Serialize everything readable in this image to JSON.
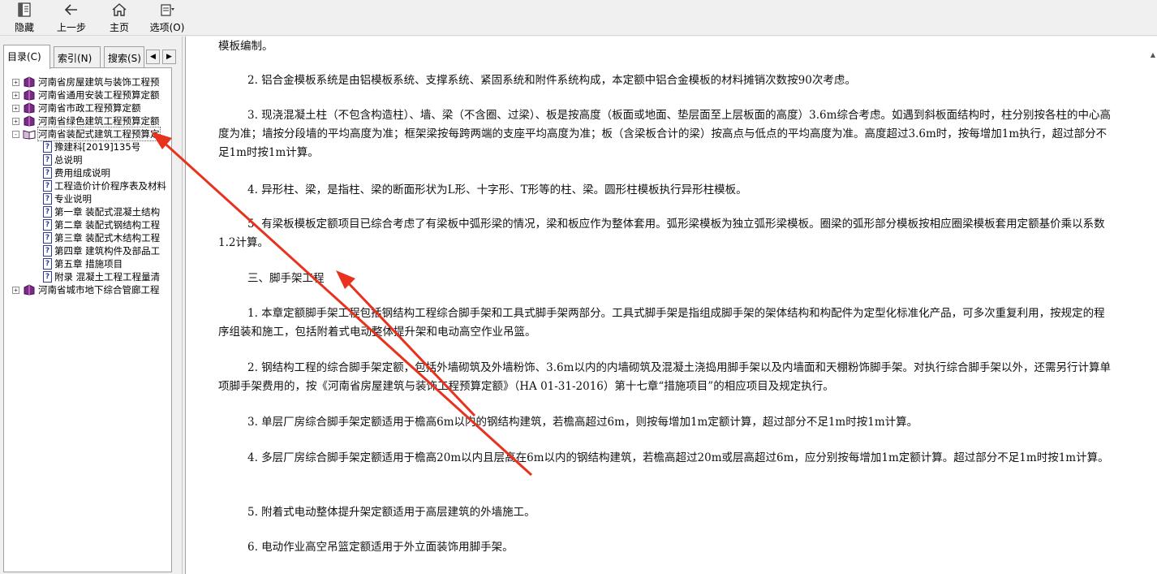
{
  "toolbar": {
    "hide_label": "隐藏",
    "back_label": "上一步",
    "home_label": "主页",
    "options_label": "选项(O)"
  },
  "tabs": {
    "toc_label": "目录(C)",
    "index_label": "索引(N)",
    "search_label": "搜索(S)"
  },
  "tree": {
    "items": [
      {
        "label": "河南省房屋建筑与装饰工程预",
        "expander": "+"
      },
      {
        "label": "河南省通用安装工程预算定额",
        "expander": "+"
      },
      {
        "label": "河南省市政工程预算定额",
        "expander": "+"
      },
      {
        "label": "河南省绿色建筑工程预算定额",
        "expander": "+"
      },
      {
        "label": "河南省装配式建筑工程预算定",
        "expander": "-"
      },
      {
        "label": "河南省城市地下综合管廊工程",
        "expander": "+"
      }
    ],
    "children": [
      "豫建科[2019]135号",
      "总说明",
      "费用组成说明",
      "工程造价计价程序表及材料",
      "专业说明",
      "第一章  装配式混凝土结构",
      "第二章  装配式钢结构工程",
      "第三章  装配式木结构工程",
      "第四章  建筑构件及部品工",
      "第五章  措施项目",
      "附录  混凝土工程工程量清"
    ],
    "page_glyph": "?"
  },
  "content": {
    "p0": "模板编制。",
    "p1": "2. 铝合金模板系统是由铝模板系统、支撑系统、紧固系统和附件系统构成，本定额中铝合金模板的材料摊销次数按90次考虑。",
    "p2": "3. 现浇混凝土柱（不包含构造柱）、墙、梁（不含圈、过梁）、板是按高度（板面或地面、垫层面至上层板面的高度）3.6m综合考虑。如遇到斜板面结构时，柱分别按各柱的中心高度为准；墙按分段墙的平均高度为准；框架梁按每跨两端的支座平均高度为准；板（含梁板合计的梁）按高点与低点的平均高度为准。高度超过3.6m时，按每增加1m执行，超过部分不足1m时按1m计算。",
    "p3": "4. 异形柱、梁，是指柱、梁的断面形状为L形、十字形、T形等的柱、梁。圆形柱模板执行异形柱模板。",
    "p4": "5. 有梁板模板定额项目已综合考虑了有梁板中弧形梁的情况，梁和板应作为整体套用。弧形梁模板为独立弧形梁模板。圈梁的弧形部分模板按相应圈梁模板套用定额基价乘以系数1.2计算。",
    "heading": "三、脚手架工程",
    "q1": "1. 本章定额脚手架工程包括钢结构工程综合脚手架和工具式脚手架两部分。工具式脚手架是指组成脚手架的架体结构和构配件为定型化标准化产品，可多次重复利用，按规定的程序组装和施工，包括附着式电动整体提升架和电动高空作业吊篮。",
    "q2": "2. 钢结构工程的综合脚手架定额，包括外墙砌筑及外墙粉饰、3.6m以内的内墙砌筑及混凝土浇捣用脚手架以及内墙面和天棚粉饰脚手架。对执行综合脚手架以外，还需另行计算单项脚手架费用的，按《河南省房屋建筑与装饰工程预算定额》（HA 01-31-2016）第十七章“措施项目”的相应项目及规定执行。",
    "q3": "3. 单层厂房综合脚手架定额适用于檐高6m以内的钢结构建筑，若檐高超过6m，则按每增加1m定额计算，超过部分不足1m时按1m计算。",
    "q4": "4. 多层厂房综合脚手架定额适用于檐高20m以内且层高在6m以内的钢结构建筑，若檐高超过20m或层高超过6m，应分别按每增加1m定额计算。超过部分不足1m时按1m计算。",
    "q5": "5. 附着式电动整体提升架定额适用于高层建筑的外墙施工。",
    "q6": "6. 电动作业高空吊篮定额适用于外立面装饰用脚手架。"
  },
  "colors": {
    "annotation_arrow": "#e8321e",
    "book_icon": "#7a2a8c",
    "page_icon": "#2a3d8f"
  }
}
